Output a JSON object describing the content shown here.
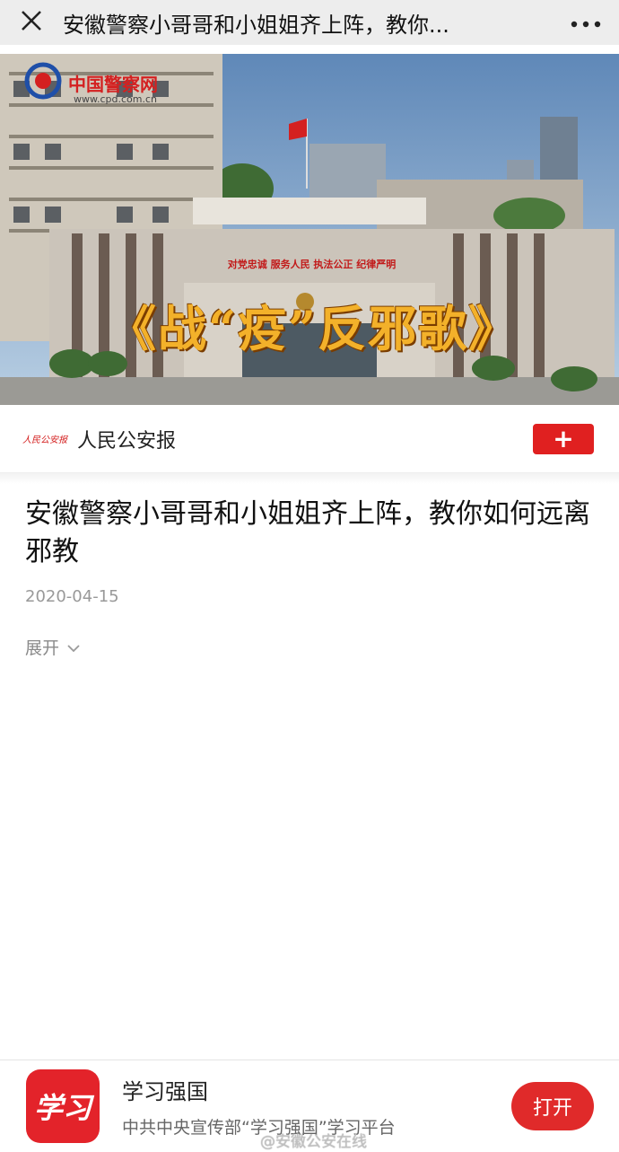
{
  "topbar": {
    "title": "安徽警察小哥哥和小姐姐齐上阵，教你..."
  },
  "video": {
    "overlay_title": "《战“疫”反邪歌》",
    "banner_text": "对党忠诚 服务人民 执法公正 纪律严明",
    "watermark_logo_text": "中国警察网",
    "watermark_url": "www.cpd.com.cn"
  },
  "publisher": {
    "logo_text": "人民公安报",
    "name": "人民公安报",
    "follow_label": "+"
  },
  "article": {
    "title": "安徽警察小哥哥和小姐姐齐上阵，教你如何远离邪教",
    "date": "2020-04-15",
    "expand_label": "展开"
  },
  "appbar": {
    "icon_text": "学习",
    "name": "学习强国",
    "description": "中共中央宣传部“学习强国”学习平台",
    "open_label": "打开"
  },
  "weibo_watermark": "@安徽公安在线",
  "colors": {
    "accent_red": "#e02020",
    "topbar_bg": "#ededed"
  }
}
